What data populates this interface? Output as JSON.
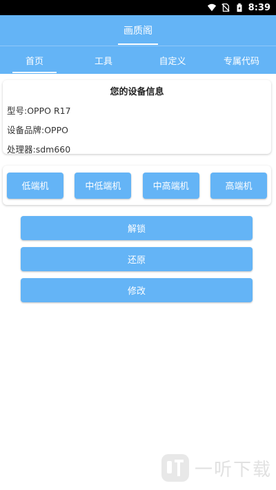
{
  "status_bar": {
    "time": "8:39"
  },
  "app_bar": {
    "title": "画质阁"
  },
  "tabs": [
    {
      "label": "首页",
      "active": true
    },
    {
      "label": "工具",
      "active": false
    },
    {
      "label": "自定义",
      "active": false
    },
    {
      "label": "专属代码",
      "active": false
    }
  ],
  "device_info": {
    "title": "您的设备信息",
    "model": "型号:OPPO R17",
    "brand": "设备品牌:OPPO",
    "processor": "处理器:sdm660"
  },
  "levels": [
    "低端机",
    "中低端机",
    "中高端机",
    "高端机"
  ],
  "actions": [
    "解锁",
    "还原",
    "修改"
  ],
  "watermark": {
    "text": "一听下载"
  },
  "colors": {
    "primary": "#64b4f6",
    "status_bar": "#000000"
  }
}
